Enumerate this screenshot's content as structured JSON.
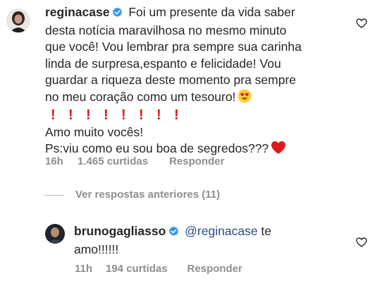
{
  "comment1": {
    "username": "reginacase",
    "line1": "Foi  um presente da vida saber",
    "line2": "desta notícia maravilhosa no mesmo minuto",
    "line3": "que você! Vou lembrar pra sempre sua carinha",
    "line4": "linda de surpresa,espanto e felicidade! Vou",
    "line5": "guardar a riqueza deste momento pra sempre",
    "line6": "no meu coração como um tesouro!",
    "emoji_after_line6": "smiling-face-with-heart-eyes-icon",
    "exclamations": [
      "!",
      "!",
      "!",
      "!",
      "!",
      "!",
      "!",
      "!"
    ],
    "exclamation_color": "#e0171f",
    "line7": "Amo muito vocês!",
    "line8": "Ps:viu como eu sou boa de segredos???",
    "emoji_after_line8": "red-heart-icon",
    "time": "16h",
    "likes": "1.465 curtidas",
    "reply_label": "Responder"
  },
  "view_replies": {
    "label": "Ver respostas anteriores (11)"
  },
  "reply1": {
    "username": "brunogagliasso",
    "mention": "@reginacase",
    "text_after_mention": " te",
    "line2": "amo!!!!!!",
    "time": "11h",
    "likes": "194 curtidas",
    "reply_label": "Responder"
  },
  "colors": {
    "text": "#262626",
    "meta": "#8e8e8e",
    "mention": "#2b4c86",
    "verified": "#3897f0"
  }
}
